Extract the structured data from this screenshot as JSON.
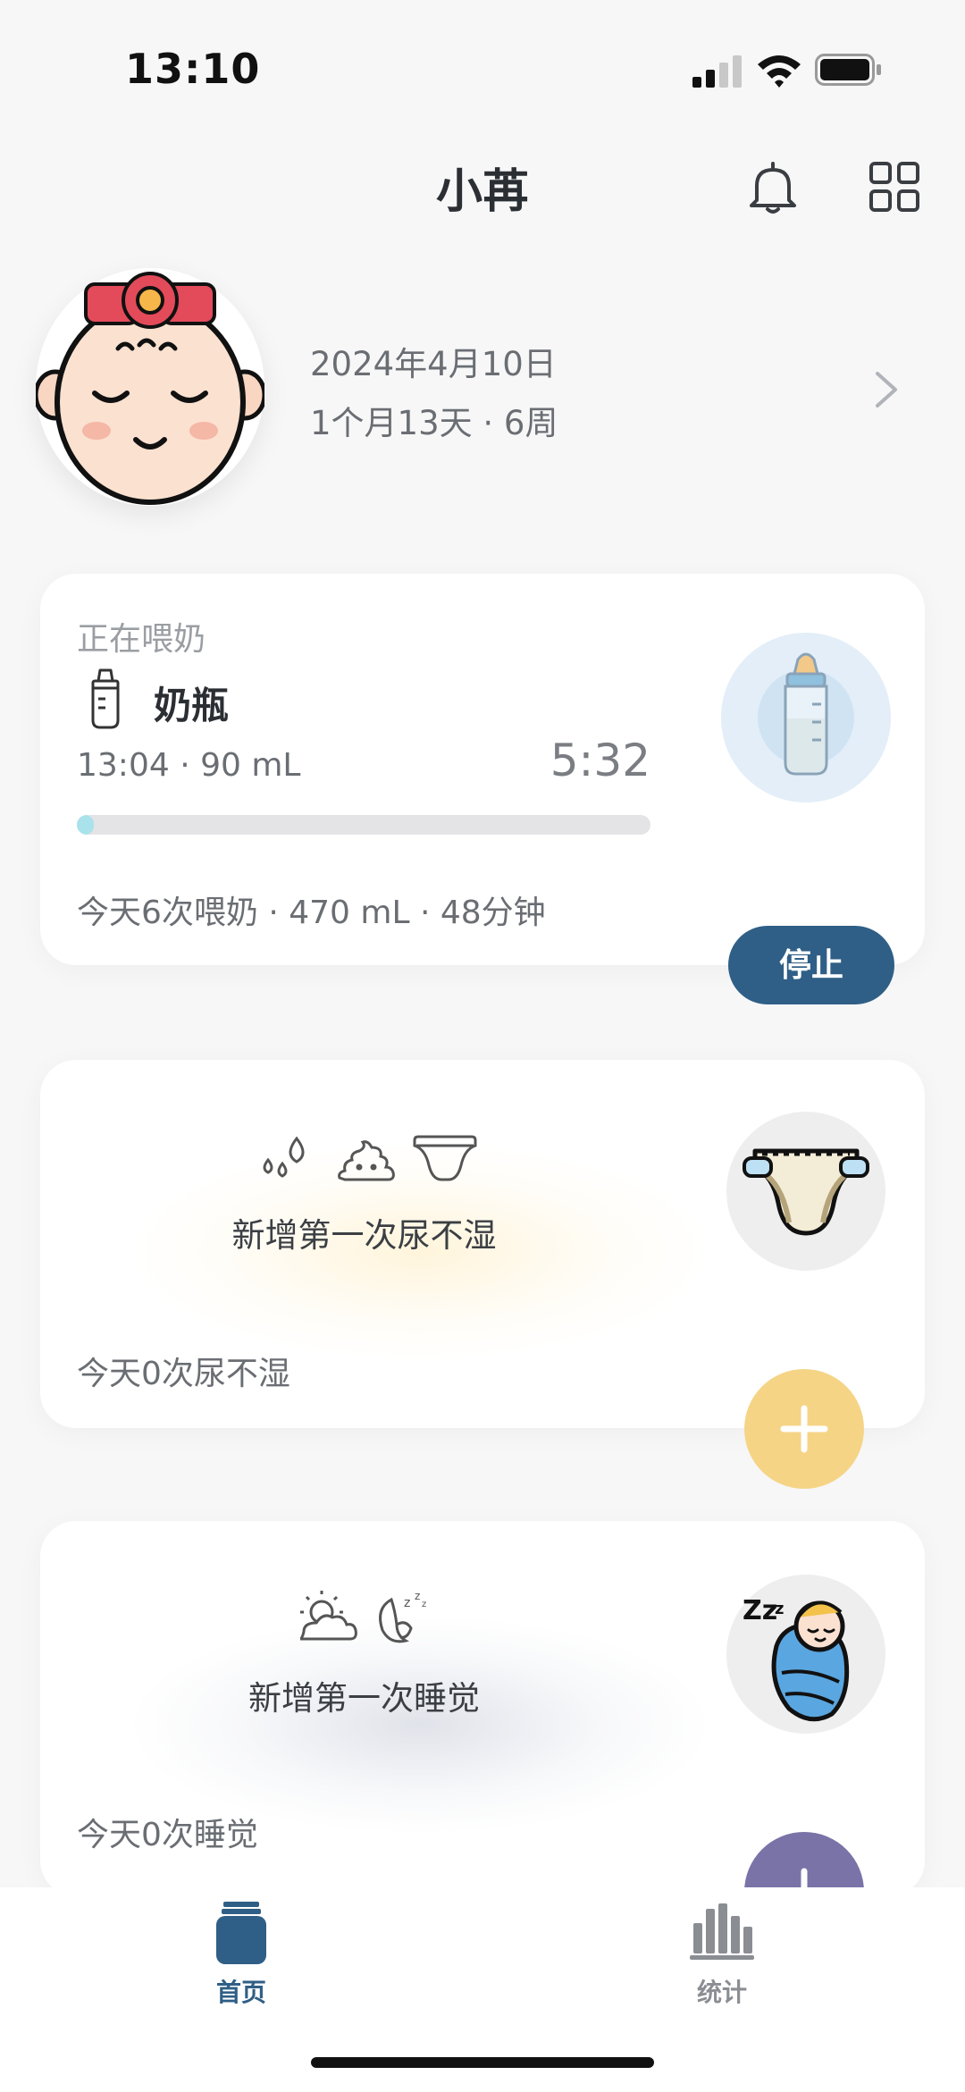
{
  "status_bar": {
    "time": "13:10"
  },
  "header": {
    "title": "小苒"
  },
  "profile": {
    "birth_date": "2024年4月10日",
    "age": "1个月13天 · 6周"
  },
  "feeding_card": {
    "status": "正在喂奶",
    "type": "奶瓶",
    "meta": "13:04 · 90 mL",
    "timer": "5:32",
    "progress": 0.03,
    "summary": "今天6次喂奶 · 470 mL · 48分钟",
    "stop_label": "停止"
  },
  "diaper_card": {
    "prompt": "新增第一次尿不湿",
    "summary": "今天0次尿不湿"
  },
  "sleep_card": {
    "prompt": "新增第一次睡觉",
    "summary": "今天0次睡觉"
  },
  "tabs": [
    {
      "label": "首页",
      "active": true
    },
    {
      "label": "统计",
      "active": false
    }
  ],
  "colors": {
    "accent": "#2f5f86",
    "diaper_add": "#f5d486",
    "sleep_add": "#7a73a8",
    "progress": "#a9e2ea"
  }
}
